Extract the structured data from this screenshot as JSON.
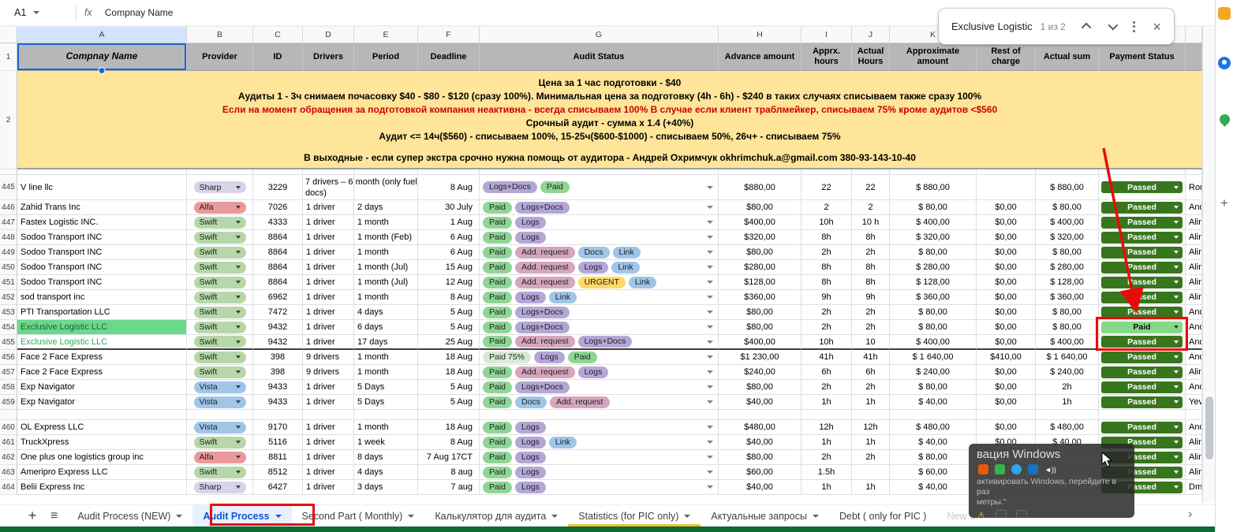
{
  "formula_bar": {
    "cell_ref": "A1",
    "fx_label": "fx",
    "value": "Compnay Name"
  },
  "find_bar": {
    "query": "Exclusive Logistic",
    "counter": "1 из 2"
  },
  "icons": {
    "close": "×",
    "add_tab": "+",
    "all_sheets": "≡",
    "next": "›",
    "plus_panel": "+",
    "warning": "⚠",
    "speaker": "◄))"
  },
  "colors": {
    "accent_red": "#ea0a0a",
    "selection_blue": "#1967d2",
    "header_bg": "#b7b7b7",
    "banner_bg": "#ffe599",
    "banner_red_text": "#cc0000",
    "found_cell_green": "#69d98c",
    "green_company_text": "#34a853",
    "passed_green": "#38761d",
    "paid_light_green": "#86d986",
    "active_tab_blue": "#0b57d0",
    "statistics_tab_yellow": "#f1c232",
    "bottom_strip_green": "#0e6b33"
  },
  "provider_colors": {
    "Sharp": "#d9d2e9",
    "Alfa": "#ea9999",
    "Swift": "#b6d7a8",
    "Vista": "#9fc5e8"
  },
  "chip_colors": {
    "Paid": "#8fd694",
    "Paid 75%": "#d9ead3",
    "Logs+Docs": "#b4a7d6",
    "Logs": "#b4a7d6",
    "Add. request": "#d5a6bd",
    "Docs": "#9fc5e8",
    "Link": "#9fc5e8",
    "URGENT": "#ffd966"
  },
  "gutter": {
    "header_row_num": "1",
    "banner_row_num": "2"
  },
  "columns": [
    {
      "letter": "A",
      "label": "Compnay Name"
    },
    {
      "letter": "B",
      "label": "Provider"
    },
    {
      "letter": "C",
      "label": "ID"
    },
    {
      "letter": "D",
      "label": "Drivers"
    },
    {
      "letter": "E",
      "label": "Period"
    },
    {
      "letter": "F",
      "label": "Deadline"
    },
    {
      "letter": "G",
      "label": "Audit Status"
    },
    {
      "letter": "H",
      "label": "Advance amount"
    },
    {
      "letter": "I",
      "label": "Apprx. hours"
    },
    {
      "letter": "J",
      "label": "Actual Hours"
    },
    {
      "letter": "K",
      "label": "Approximate amount"
    },
    {
      "letter": "",
      "label": "Rest of charge"
    },
    {
      "letter": "",
      "label": "Actual sum"
    },
    {
      "letter": "",
      "label": "Payment Status"
    },
    {
      "letter": "",
      "label": ""
    }
  ],
  "banner": {
    "lines": [
      {
        "text": "Цена за 1 час подготовки - $40",
        "color": "black"
      },
      {
        "text": "Аудиты 1 - 3ч снимаем почасовку $40 - $80 - $120 (сразу 100%). Минимальная цена за подготовку (4h - 6h) - $240  в таких случаях списываем также сразу 100%",
        "color": "black"
      },
      {
        "text": "Если на момент обращения за подготовкой компания неактивна - всегда списываем 100% В случае если клиент траблмейкер, списываем 75% кроме аудитов <$560",
        "color": "red"
      },
      {
        "text": "Срочный аудит - сумма х 1.4  (+40%)",
        "color": "black"
      },
      {
        "text": "Аудит <= 14ч($560) - списываем 100%, 15-25ч($600-$1000) - списываем 50%, 26ч+  - списываем 75%",
        "color": "black"
      },
      {
        "text": "",
        "color": "black"
      },
      {
        "text": "В выходные - если супер экстра срочно нужна помощь от аудитора - Андрей Охримчук okhrimchuk.a@gmail.com 380-93-143-10-40",
        "color": "black"
      }
    ]
  },
  "rows": [
    {
      "num": "445",
      "h": 32,
      "company": "V line llc",
      "provider": "Sharp",
      "id": "3229",
      "drivers": "7 drivers – 6 month (only fuel docs)",
      "drivers_overflow": true,
      "period": "",
      "deadline": "8 Aug",
      "status": [
        "Logs+Docs",
        "Paid"
      ],
      "advance": "$880,00",
      "apprx": "22",
      "actual_h": "22",
      "approx": "$ 880,00",
      "rest": "",
      "actual_sum": "$ 880,00",
      "payment": "Passed",
      "pic": "Ron"
    },
    {
      "num": "446",
      "company": "Zahid Trans Inc",
      "provider": "Alfa",
      "id": "7026",
      "drivers": "1 driver",
      "period": "2 days",
      "deadline": "30 July",
      "status": [
        "Paid",
        "Logs+Docs"
      ],
      "advance": "$80,00",
      "apprx": "2",
      "actual_h": "2",
      "approx": "$ 80,00",
      "rest": "$0,00",
      "actual_sum": "$ 80,00",
      "payment": "Passed",
      "pic": "And"
    },
    {
      "num": "447",
      "company": "Fastex Logistic INC.",
      "provider": "Swift",
      "id": "4333",
      "drivers": "1 driver",
      "period": "1 month",
      "deadline": "1 Aug",
      "status": [
        "Paid",
        "Logs"
      ],
      "advance": "$400,00",
      "apprx": "10h",
      "actual_h": "10 h",
      "approx": "$ 400,00",
      "rest": "$0,00",
      "actual_sum": "$ 400,00",
      "payment": "Passed",
      "pic": "Alin"
    },
    {
      "num": "448",
      "company": "Sodoo Transport INC",
      "provider": "Swift",
      "id": "8864",
      "drivers": "1 driver",
      "period": "1 month (Feb)",
      "deadline": "6 Aug",
      "status": [
        "Paid",
        "Logs"
      ],
      "advance": "$320,00",
      "apprx": "8h",
      "actual_h": "8h",
      "approx": "$ 320,00",
      "rest": "$0,00",
      "actual_sum": "$ 320,00",
      "payment": "Passed",
      "pic": "Alin"
    },
    {
      "num": "449",
      "company": "Sodoo Transport INC",
      "provider": "Swift",
      "id": "8864",
      "drivers": "1 driver",
      "period": "1 month",
      "deadline": "6 Aug",
      "status": [
        "Paid",
        "Add. request",
        "Docs",
        "Link"
      ],
      "advance": "$80,00",
      "apprx": "2h",
      "actual_h": "2h",
      "approx": "$ 80,00",
      "rest": "$0,00",
      "actual_sum": "$ 80,00",
      "payment": "Passed",
      "pic": "Alin"
    },
    {
      "num": "450",
      "company": "Sodoo Transport INC",
      "provider": "Swift",
      "id": "8864",
      "drivers": "1 driver",
      "period": "1 month (Jul)",
      "deadline": "15 Aug",
      "status": [
        "Paid",
        "Add. request",
        "Logs",
        "Link"
      ],
      "advance": "$280,00",
      "apprx": "8h",
      "actual_h": "8h",
      "approx": "$ 280,00",
      "rest": "$0,00",
      "actual_sum": "$ 280,00",
      "payment": "Passed",
      "pic": "Alin"
    },
    {
      "num": "451",
      "company": "Sodoo Transport INC",
      "provider": "Swift",
      "id": "8864",
      "drivers": "1 driver",
      "period": "1 month (Jul)",
      "deadline": "12 Aug",
      "status": [
        "Paid",
        "Add. request",
        "URGENT",
        "Link"
      ],
      "advance": "$128,00",
      "apprx": "8h",
      "actual_h": "8h",
      "approx": "$ 128,00",
      "rest": "$0,00",
      "actual_sum": "$ 128,00",
      "payment": "Passed",
      "pic": "Alin"
    },
    {
      "num": "452",
      "company": "sod transport inc",
      "provider": "Swift",
      "id": "6962",
      "drivers": "1 driver",
      "period": "1 month",
      "deadline": "8 Aug",
      "status": [
        "Paid",
        "Logs",
        "Link"
      ],
      "advance": "$360,00",
      "apprx": "9h",
      "actual_h": "9h",
      "approx": "$ 360,00",
      "rest": "$0,00",
      "actual_sum": "$ 360,00",
      "payment": "Passed",
      "pic": "Alin"
    },
    {
      "num": "453",
      "company": "PTI Transportation LLC",
      "provider": "Swift",
      "id": "7472",
      "drivers": "1 driver",
      "period": "4 days",
      "deadline": "5 Aug",
      "status": [
        "Paid",
        "Logs+Docs"
      ],
      "advance": "$80,00",
      "apprx": "2h",
      "actual_h": "2h",
      "approx": "$ 80,00",
      "rest": "$0,00",
      "actual_sum": "$ 80,00",
      "payment": "Passed",
      "pic": "And"
    },
    {
      "num": "454",
      "company": "Exclusive Logistic LLC",
      "company_style": "found",
      "provider": "Swift",
      "id": "9432",
      "drivers": "1 driver",
      "period": "6 days",
      "deadline": "5 Aug",
      "status": [
        "Paid",
        "Logs+Docs"
      ],
      "advance": "$80,00",
      "apprx": "2h",
      "actual_h": "2h",
      "approx": "$ 80,00",
      "rest": "$0,00",
      "actual_sum": "$ 80,00",
      "payment": "Paid",
      "pic": "And"
    },
    {
      "num": "455",
      "company": "Exclusive Logistic LLC",
      "company_style": "green",
      "provider": "Swift",
      "id": "9432",
      "drivers": "1 driver",
      "period": "17 days",
      "deadline": "25 Aug",
      "status": [
        "Paid",
        "Add. request",
        "Logs+Docs"
      ],
      "advance": "$400,00",
      "apprx": "10h",
      "actual_h": "10",
      "approx": "$ 400,00",
      "rest": "$0,00",
      "actual_sum": "$ 400,00",
      "payment": "Passed",
      "pic": "And",
      "thick_bottom": true
    },
    {
      "num": "456",
      "company": "Face 2 Face Express",
      "provider": "Swift",
      "id": "398",
      "drivers": "9 drivers",
      "period": "1 month",
      "deadline": "18 Aug",
      "status": [
        "Paid 75%",
        "Logs",
        "Paid"
      ],
      "advance": "$1 230,00",
      "apprx": "41h",
      "actual_h": "41h",
      "approx": "$ 1 640,00",
      "rest": "$410,00",
      "actual_sum": "$ 1 640,00",
      "payment": "Passed",
      "pic": "And"
    },
    {
      "num": "457",
      "company": "Face 2 Face Express",
      "provider": "Swift",
      "id": "398",
      "drivers": "9 drivers",
      "period": "1 month",
      "deadline": "18 Aug",
      "status": [
        "Paid",
        "Add. request",
        "Logs"
      ],
      "advance": "$240,00",
      "apprx": "6h",
      "actual_h": "6h",
      "approx": "$ 240,00",
      "rest": "$0,00",
      "actual_sum": "$ 240,00",
      "payment": "Passed",
      "pic": "Alin"
    },
    {
      "num": "458",
      "company": "Exp Navigator",
      "provider": "Vista",
      "id": "9433",
      "drivers": "1 driver",
      "period": "5 Days",
      "deadline": "5 Aug",
      "status": [
        "Paid",
        "Logs+Docs"
      ],
      "advance": "$80,00",
      "apprx": "2h",
      "actual_h": "2h",
      "approx": "$ 80,00",
      "rest": "$0,00",
      "actual_sum": "2h",
      "payment": "Passed",
      "pic": "And"
    },
    {
      "num": "459",
      "company": "Exp Navigator",
      "provider": "Vista",
      "id": "9433",
      "drivers": "1 driver",
      "period": "5 Days",
      "deadline": "5 Aug",
      "status": [
        "Paid",
        "Docs",
        "Add. request"
      ],
      "advance": "$40,00",
      "apprx": "1h",
      "actual_h": "1h",
      "approx": "$ 40,00",
      "rest": "$0,00",
      "actual_sum": "1h",
      "payment": "Passed",
      "pic": "Yev"
    },
    {
      "spacer": true,
      "h": 13
    },
    {
      "num": "460",
      "company": "OL Express LLC",
      "provider": "Vista",
      "id": "9170",
      "drivers": "1 driver",
      "period": "1 month",
      "deadline": "18 Aug",
      "status": [
        "Paid",
        "Logs"
      ],
      "advance": "$480,00",
      "apprx": "12h",
      "actual_h": "12h",
      "approx": "$ 480,00",
      "rest": "$0,00",
      "actual_sum": "$ 480,00",
      "payment": "Passed",
      "pic": "And"
    },
    {
      "num": "461",
      "company": "TruckXpress",
      "provider": "Swift",
      "id": "5116",
      "drivers": "1 driver",
      "period": "1 week",
      "deadline": "8 Aug",
      "status": [
        "Paid",
        "Logs",
        "Link"
      ],
      "advance": "$40,00",
      "apprx": "1h",
      "actual_h": "1h",
      "approx": "$ 40,00",
      "rest": "$0,00",
      "actual_sum": "$ 40,00",
      "payment": "Passed",
      "pic": "Alin"
    },
    {
      "num": "462",
      "company": "One plus one logistics group inc",
      "provider": "Alfa",
      "id": "8811",
      "drivers": "1 driver",
      "period": "8 days",
      "deadline": "7 Aug 17CT",
      "status": [
        "Paid",
        "Logs"
      ],
      "advance": "$80,00",
      "apprx": "2h",
      "actual_h": "2h",
      "approx": "$ 80,00",
      "rest": "",
      "actual_sum": "",
      "payment": "Passed",
      "pic": "Alin"
    },
    {
      "num": "463",
      "company": "Ameripro Express LLC",
      "provider": "Swift",
      "id": "8512",
      "drivers": "1 driver",
      "period": "4 days",
      "deadline": "8 aug",
      "status": [
        "Paid",
        "Logs"
      ],
      "advance": "$60,00",
      "apprx": "1.5h",
      "actual_h": "",
      "approx": "$ 60,00",
      "rest": "",
      "actual_sum": "",
      "payment": "Passed",
      "pic": "Alin"
    },
    {
      "num": "464",
      "company": "Belii Express Inc",
      "provider": "Sharp",
      "id": "6427",
      "drivers": "1 driver",
      "period": "3 days",
      "deadline": "7 aug",
      "status": [
        "Paid",
        "Logs"
      ],
      "advance": "$40,00",
      "apprx": "1h",
      "actual_h": "1h",
      "approx": "$ 40,00",
      "rest": "",
      "actual_sum": "",
      "payment": "Passed",
      "pic": "Dmi"
    }
  ],
  "tabs": {
    "items": [
      {
        "label": "Audit Process (NEW)",
        "has_dropdown": true
      },
      {
        "label": "Audit Process",
        "has_dropdown": true,
        "active": true,
        "annotated": true
      },
      {
        "label": "Second Part ( Monthly)",
        "has_dropdown": true
      },
      {
        "label": "Калькулятор для аудита",
        "has_dropdown": true
      },
      {
        "label": "Statistics (for PIC only)",
        "has_dropdown": true,
        "tab_color": "#f1c232"
      },
      {
        "label": "Актуальные запросы",
        "has_dropdown": true
      },
      {
        "label": "Debt ( only for PIC )",
        "has_dropdown": false
      },
      {
        "label": "New Sh",
        "has_dropdown": false,
        "partial": true
      }
    ]
  },
  "windows_overlay": {
    "title": "вация Windows",
    "line2": "активировать Windows, перейдите в раз",
    "line3": "метры.\""
  }
}
